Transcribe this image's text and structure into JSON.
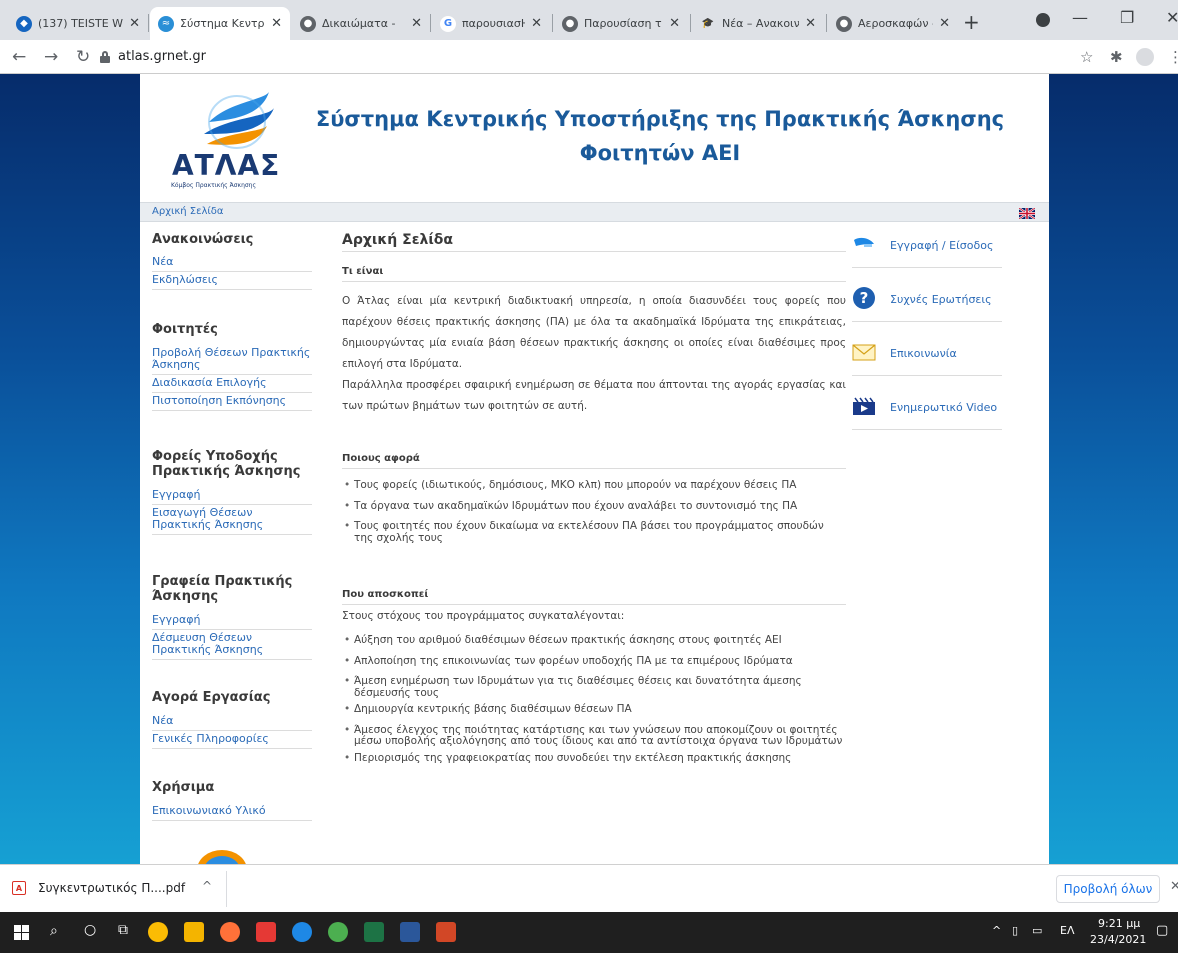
{
  "browser": {
    "tabs": [
      {
        "title": "(137) TEISTE W",
        "active": false
      },
      {
        "title": "Σύστημα Κεντρ",
        "active": true
      },
      {
        "title": "Δικαιώματα - ",
        "active": false
      },
      {
        "title": "παρουσιασΗ Π",
        "active": false
      },
      {
        "title": "Παρουσίαση τ",
        "active": false
      },
      {
        "title": "Νέα – Ανακοιν",
        "active": false
      },
      {
        "title": "Αεροσκαφών -",
        "active": false
      }
    ],
    "url": "atlas.grnet.gr"
  },
  "site": {
    "logo_text": "ΑΤΛΑΣ",
    "logo_sub": "Κόμβος Πρακτικής Άσκησης",
    "title_line1": "Σύστημα Κεντρικής Υποστήριξης της Πρακτικής Άσκησης",
    "title_line2": "Φοιτητών ΑΕΙ",
    "breadcrumb": "Αρχική Σελίδα"
  },
  "leftnav": [
    {
      "heading": "Ανακοινώσεις",
      "links": [
        "Νέα",
        "Εκδηλώσεις"
      ]
    },
    {
      "heading": "Φοιτητές",
      "links": [
        "Προβολή Θέσεων Πρακτικής Άσκησης",
        "Διαδικασία Επιλογής",
        "Πιστοποίηση Εκπόνησης"
      ]
    },
    {
      "heading": "Φορείς Υποδοχής Πρακτικής Άσκησης",
      "links": [
        "Εγγραφή",
        "Εισαγωγή Θέσεων Πρακτικής Άσκησης"
      ]
    },
    {
      "heading": "Γραφεία Πρακτικής Άσκησης",
      "links": [
        "Εγγραφή",
        "Δέσμευση Θέσεων Πρακτικής Άσκησης"
      ]
    },
    {
      "heading": "Αγορά Εργασίας",
      "links": [
        "Νέα",
        "Γενικές Πληροφορίες"
      ]
    },
    {
      "heading": "Χρήσιμα",
      "links": [
        "Επικοινωνιακό Υλικό"
      ]
    }
  ],
  "main": {
    "heading": "Αρχική Σελίδα",
    "what_title": "Τι είναι",
    "what_p1": "Ο Άτλας είναι μία κεντρική διαδικτυακή υπηρεσία, η οποία διασυνδέει τους φορείς που παρέχουν θέσεις πρακτικής άσκησης (ΠΑ) με όλα τα ακαδημαϊκά Ιδρύματα της επικράτειας, δημιουργώντας μία ενιαία βάση θέσεων πρακτικής άσκησης οι οποίες είναι διαθέσιμες προς επιλογή στα Ιδρύματα.",
    "what_p2": "Παράλληλα προσφέρει σφαιρική ενημέρωση σε θέματα που άπτονται της αγοράς εργασίας και των πρώτων βημάτων των φοιτητών σε αυτή.",
    "who_title": "Ποιους αφορά",
    "who_items": [
      "Τους φορείς (ιδιωτικούς, δημόσιους, ΜΚΟ κλπ) που μπορούν να παρέχουν θέσεις ΠΑ",
      "Τα όργανα των ακαδημαϊκών Ιδρυμάτων που έχουν αναλάβει το συντονισμό της ΠΑ",
      "Τους φοιτητές που έχουν δικαίωμα να εκτελέσουν ΠΑ βάσει του προγράμματος σπουδών της σχολής τους"
    ],
    "aim_title": "Που αποσκοπεί",
    "aim_intro": "Στους στόχους του προγράμματος συγκαταλέγονται:",
    "aim_items": [
      "Αύξηση του αριθμού διαθέσιμων θέσεων πρακτικής άσκησης στους φοιτητές ΑΕΙ",
      "Απλοποίηση της επικοινωνίας των φορέων υποδοχής ΠΑ με τα επιμέρους Ιδρύματα",
      "Άμεση ενημέρωση των Ιδρυμάτων για τις διαθέσιμες θέσεις και δυνατότητα άμεσης δέσμευσής τους",
      "Δημιουργία κεντρικής βάσης διαθέσιμων θέσεων ΠΑ",
      "Άμεσος έλεγχος της ποιότητας κατάρτισης και των γνώσεων που αποκομίζουν οι φοιτητές μέσω υποβολής αξιολόγησης από τους ίδιους και από τα αντίστοιχα όργανα των Ιδρυμάτων",
      "Περιορισμός της γραφειοκρατίας που συνοδεύει την εκτέλεση πρακτικής άσκησης"
    ]
  },
  "rightnav": [
    {
      "label": "Εγγραφή / Είσοδος",
      "icon": "login-key-icon"
    },
    {
      "label": "Συχνές Ερωτήσεις",
      "icon": "help-icon"
    },
    {
      "label": "Επικοινωνία",
      "icon": "envelope-icon"
    },
    {
      "label": "Ενημερωτικό Video",
      "icon": "video-icon"
    }
  ],
  "downloads": {
    "file": "Συγκεντρωτικός Π....pdf",
    "show_all": "Προβολή όλων"
  },
  "taskbar": {
    "lang": "ΕΛ",
    "time": "9:21 μμ",
    "date": "23/4/2021"
  },
  "colors": {
    "title_blue": "#1a5a9a",
    "link_blue": "#2a6ab7",
    "bg_gradient_top": "#062c6b",
    "bg_gradient_bottom": "#16a0d3"
  }
}
